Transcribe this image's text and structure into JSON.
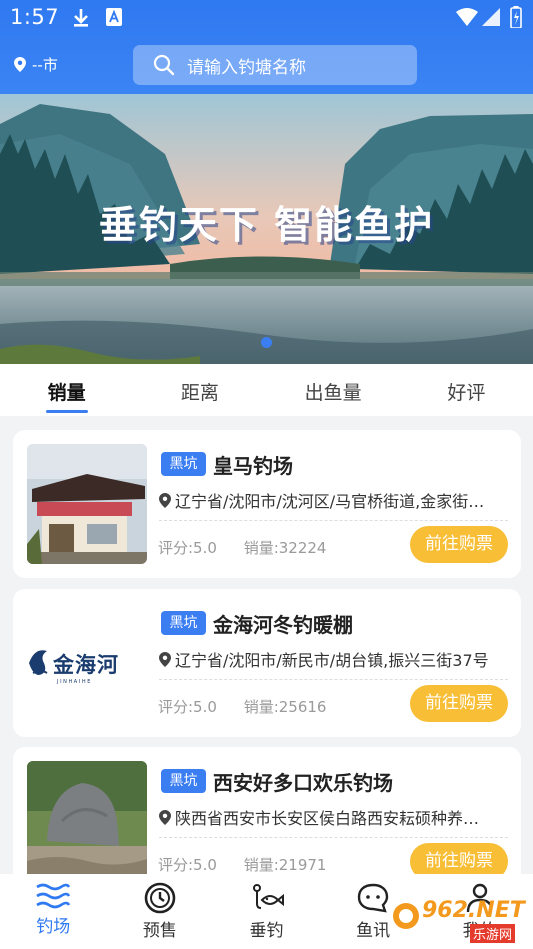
{
  "status_bar": {
    "time": "1:57"
  },
  "header": {
    "location": "--市",
    "search_placeholder": "请输入钓塘名称"
  },
  "banner": {
    "slogan": "垂钓天下  智能鱼护"
  },
  "tabs": [
    {
      "label": "销量",
      "active": true
    },
    {
      "label": "距离",
      "active": false
    },
    {
      "label": "出鱼量",
      "active": false
    },
    {
      "label": "好评",
      "active": false
    }
  ],
  "listings": [
    {
      "tag": "黑坑",
      "name": "皇马钓场",
      "address": "辽宁省/沈阳市/沈河区/马官桥街道,金家街…",
      "rating": "评分:5.0",
      "sales": "销量:32224",
      "button": "前往购票"
    },
    {
      "tag": "黑坑",
      "name": "金海河冬钓暖棚",
      "address": "辽宁省/沈阳市/新民市/胡台镇,振兴三街37号",
      "rating": "评分:5.0",
      "sales": "销量:25616",
      "button": "前往购票",
      "logo_text": "金海河",
      "logo_sub": "J I N H A I H E"
    },
    {
      "tag": "黑坑",
      "name": "西安好多口欢乐钓场",
      "address": "陕西省西安市长安区侯白路西安耘硕种养…",
      "rating": "评分:5.0",
      "sales": "销量:21971",
      "button": "前往购票"
    }
  ],
  "bottom_nav": [
    {
      "label": "钓场",
      "icon": "waves-icon",
      "active": true
    },
    {
      "label": "预售",
      "icon": "clock-icon",
      "active": false
    },
    {
      "label": "垂钓",
      "icon": "fishing-icon",
      "active": false
    },
    {
      "label": "鱼讯",
      "icon": "chat-icon",
      "active": false
    },
    {
      "label": "我的",
      "icon": "user-icon",
      "active": false
    }
  ],
  "watermark": {
    "text": "962.NET",
    "sub": "乐游网"
  },
  "colors": {
    "primary": "#2f79f1",
    "button": "#f8be35",
    "tag": "#3b7ef2"
  }
}
